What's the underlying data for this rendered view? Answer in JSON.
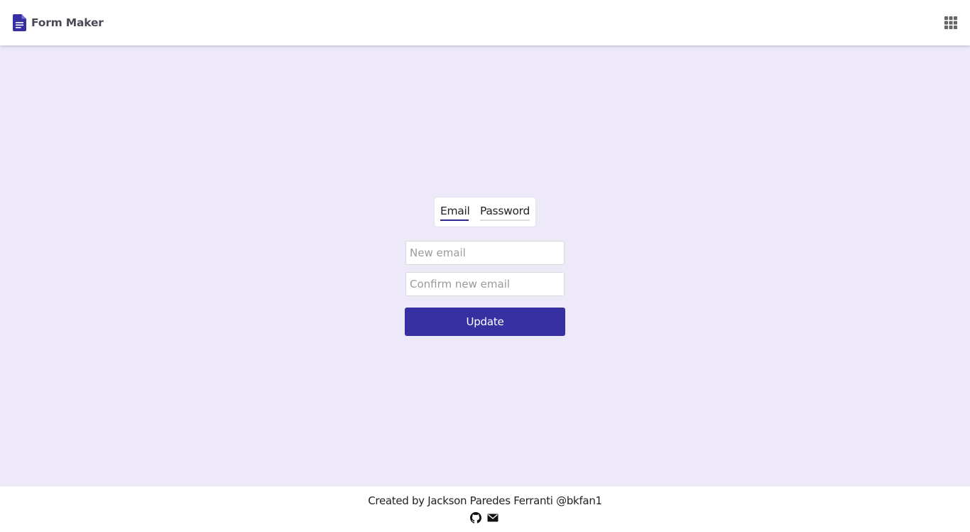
{
  "header": {
    "brand_title": "Form Maker",
    "brand_icon": "document-icon",
    "apps_icon": "apps-grid-icon"
  },
  "tabs": [
    {
      "label": "Email",
      "active": true
    },
    {
      "label": "Password",
      "active": false
    }
  ],
  "form": {
    "new_email_placeholder": "New email",
    "new_email_value": "",
    "confirm_email_placeholder": "Confirm new email",
    "confirm_email_value": "",
    "submit_label": "Update"
  },
  "footer": {
    "credit": "Created by Jackson Paredes Ferranti @bkfan1",
    "icons": [
      "github-icon",
      "mail-icon"
    ]
  },
  "colors": {
    "brand": "#3730a3",
    "background": "#ede9f8",
    "surface": "#ffffff"
  }
}
